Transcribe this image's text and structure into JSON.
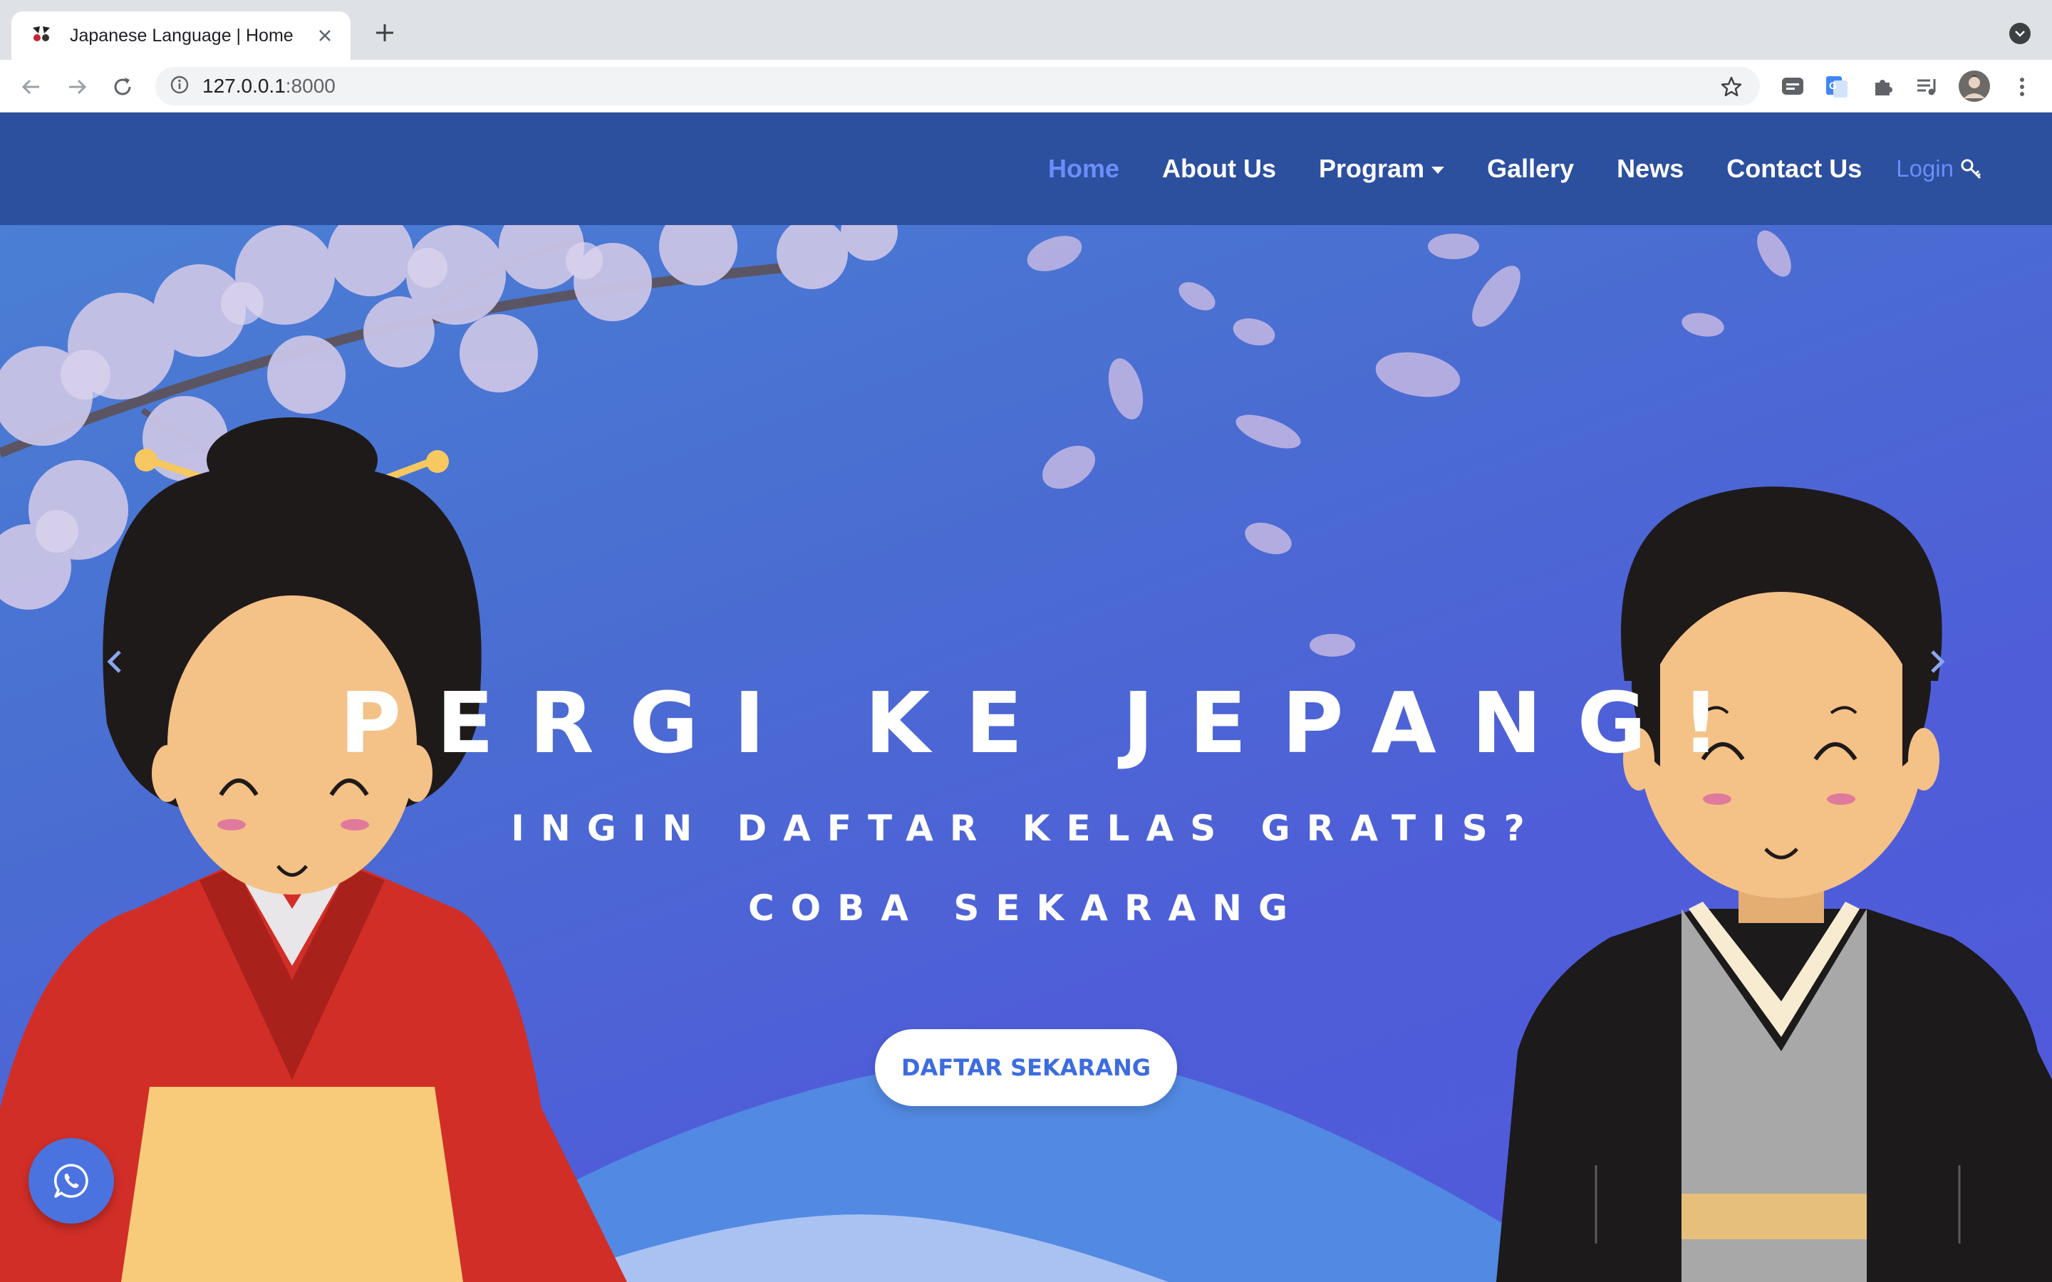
{
  "browser": {
    "tab_title": "Japanese Language | Home",
    "url_host": "127.0.0.1",
    "url_port": ":8000"
  },
  "navbar": {
    "items": [
      {
        "label": "Home",
        "active": true
      },
      {
        "label": "About Us"
      },
      {
        "label": "Program",
        "dropdown": true
      },
      {
        "label": "Gallery"
      },
      {
        "label": "News"
      },
      {
        "label": "Contact Us"
      }
    ],
    "login_label": "Login"
  },
  "hero": {
    "title": "Pergi ke Jepang!",
    "subtitle1": "Ingin daftar kelas gratis?",
    "subtitle2": "Coba sekarang",
    "cta_label": "Daftar Sekarang"
  },
  "colors": {
    "navbar_bg": "#2c4f9e",
    "nav_active": "#6b8dfa",
    "cta_text": "#3d6ce0",
    "whatsapp_bg": "#4a73e0"
  },
  "icons": {
    "login": "key-icon",
    "floating": "whatsapp-icon"
  }
}
